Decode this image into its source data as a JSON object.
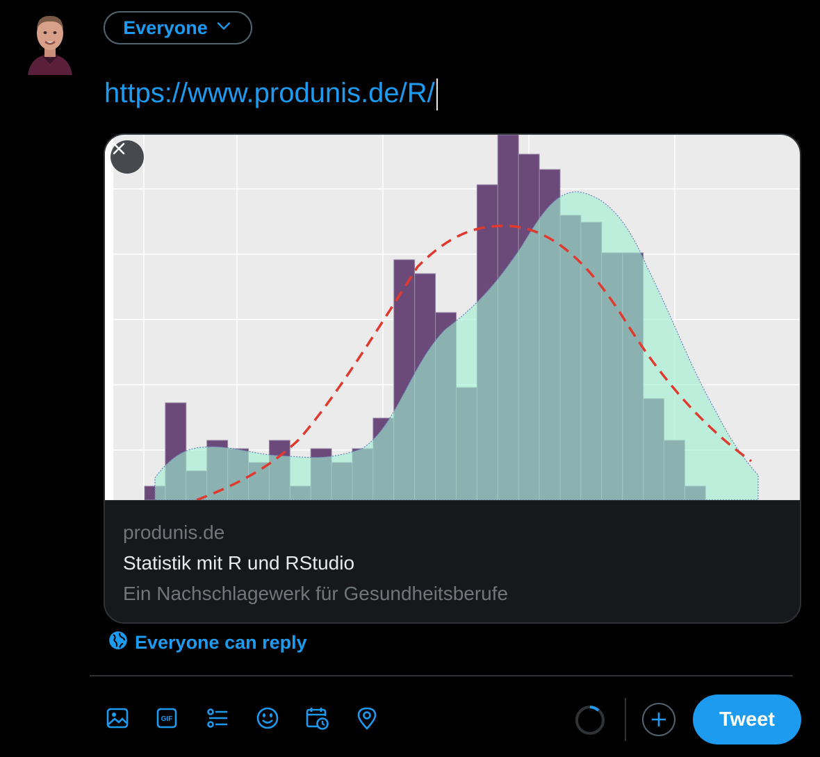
{
  "composer": {
    "audience_label": "Everyone",
    "text": "https://www.produnis.de/R/"
  },
  "link_card": {
    "domain": "produnis.de",
    "title": "Statistik mit R und RStudio",
    "description": "Ein Nachschlagewerk für Gesundheitsberufe",
    "image": {
      "bar_color": "#6b4a7a",
      "overlay_color": "#9ff0d2",
      "curve_color": "#e03a2f",
      "background": "#ebebeb"
    }
  },
  "reply_setting": {
    "label": "Everyone can reply"
  },
  "toolbar": {
    "icons": [
      "image-icon",
      "gif-icon",
      "poll-icon",
      "emoji-icon",
      "schedule-icon",
      "location-icon"
    ],
    "tweet_label": "Tweet"
  },
  "colors": {
    "accent": "#1d9bf0",
    "background": "#000000",
    "border": "#2f3336"
  }
}
